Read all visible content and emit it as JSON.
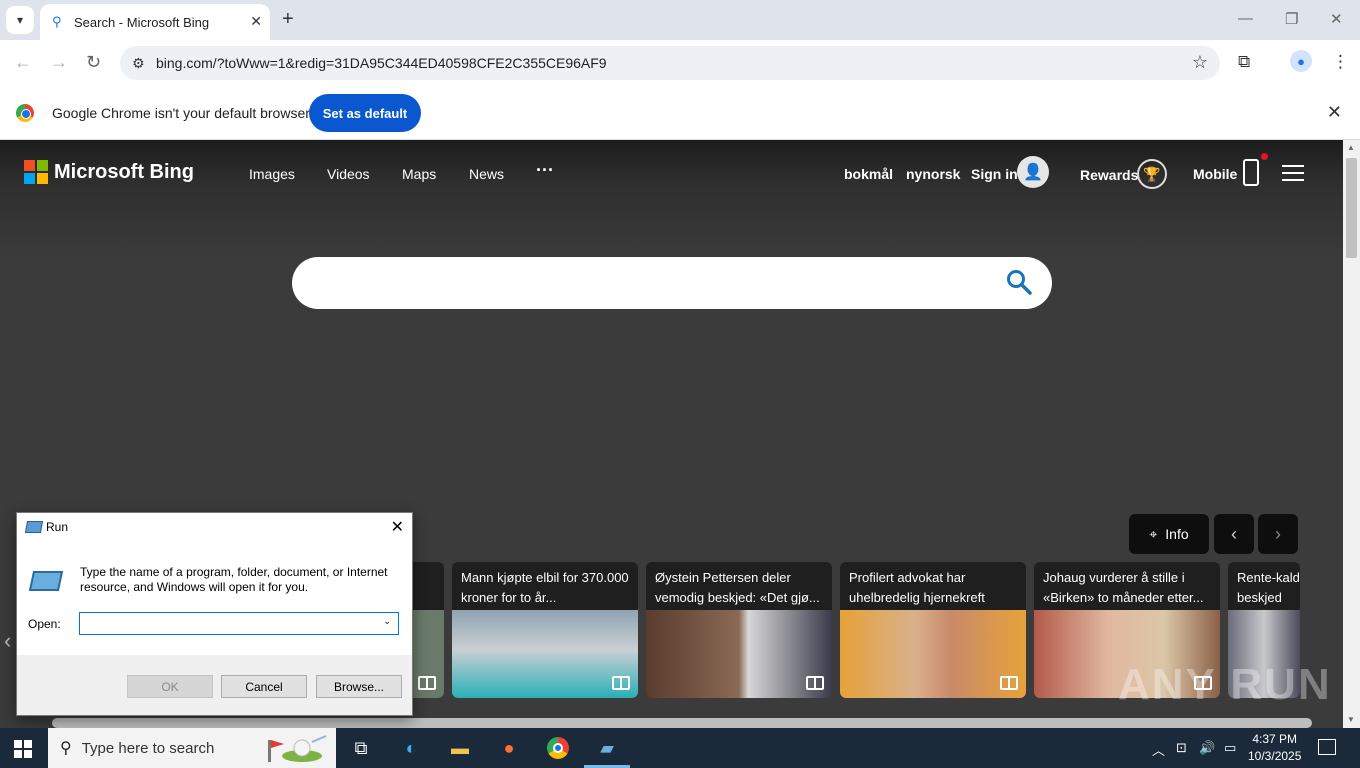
{
  "browser": {
    "tab_title": "Search - Microsoft Bing",
    "url": "bing.com/?toWww=1&redig=31DA95C344ED40598CFE2C355CE96AF9",
    "infobar_text": "Google Chrome isn't your default browser",
    "set_default_label": "Set as default"
  },
  "bing": {
    "brand": "Microsoft Bing",
    "nav": [
      "Images",
      "Videos",
      "Maps",
      "News",
      "···"
    ],
    "lang1": "bokmål",
    "lang2": "nynorsk",
    "sign_in": "Sign in",
    "rewards": "Rewards",
    "mobile": "Mobile",
    "info_label": "Info",
    "cards": [
      {
        "title": "ert"
      },
      {
        "title": "Mann kjøpte elbil for 370.000 kroner for to år..."
      },
      {
        "title": "Øystein Pettersen deler vemodig beskjed: «Det gjø..."
      },
      {
        "title": "Profilert advokat har uhelbredelig hjernekreft"
      },
      {
        "title": "Johaug vurderer å stille i «Birken» to måneder etter..."
      },
      {
        "title": "Rente-kald beskjed"
      }
    ],
    "watermark": "ANY RUN"
  },
  "run_dialog": {
    "title": "Run",
    "description": "Type the name of a program, folder, document, or Internet resource, and Windows will open it for you.",
    "open_label": "Open:",
    "open_value": "",
    "ok": "OK",
    "cancel": "Cancel",
    "browse": "Browse..."
  },
  "taskbar": {
    "search_placeholder": "Type here to search",
    "time": "4:37 PM",
    "date": "10/3/2025"
  }
}
